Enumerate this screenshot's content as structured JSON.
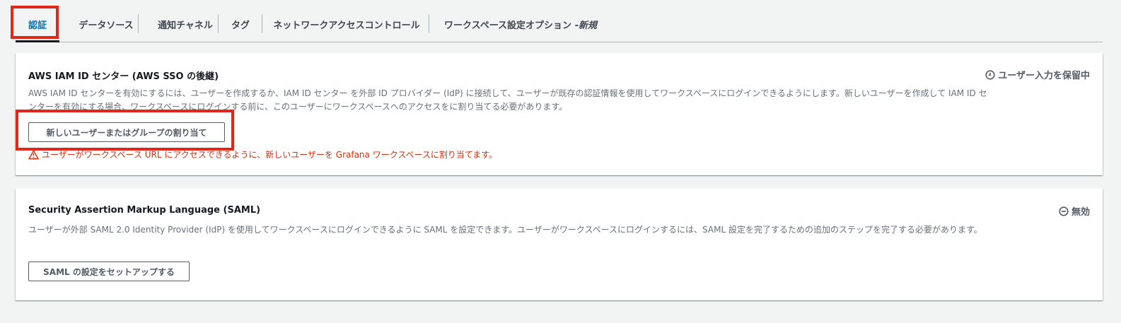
{
  "tabs": [
    {
      "label": "認証"
    },
    {
      "label": "データソース"
    },
    {
      "label": "通知チャネル"
    },
    {
      "label": "タグ"
    },
    {
      "label": "ネットワークアクセスコントロール"
    },
    {
      "label": "ワークスペース設定オプション - ",
      "suffix": "新規"
    }
  ],
  "sso_card": {
    "title": "AWS IAM ID センター (AWS SSO の後継)",
    "status": "ユーザー入力を保留中",
    "description": "AWS IAM ID センターを有効にするには、ユーザーを作成するか、IAM ID センター を外部 ID プロバイダー (IdP) に接続して、ユーザーが既存の認証情報を使用してワークスペースにログインできるようにします。新しいユーザーを作成して IAM ID センターを有効にする場合、ワークスペースにログインする前に、このユーザーにワークスペースへのアクセスをに割り当てる必要があります。",
    "button_label": "新しいユーザーまたはグループの割り当て",
    "warning": "ユーザーがワークスペース URL にアクセスできるように、新しいユーザーを Grafana ワークスペースに割り当てます。"
  },
  "saml_card": {
    "title": "Security Assertion Markup Language (SAML)",
    "status": "無効",
    "description": "ユーザーが外部 SAML 2.0 Identity Provider (IdP) を使用してワークスペースにログインできるように SAML を設定できます。ユーザーがワークスペースにログインするには、SAML 設定を完了するための追加のステップを完了する必要があります。",
    "button_label": "SAML の設定をセットアップする"
  },
  "colors": {
    "active_tab": "#0073bb",
    "warning": "#d13212",
    "highlight": "#e1261c"
  }
}
